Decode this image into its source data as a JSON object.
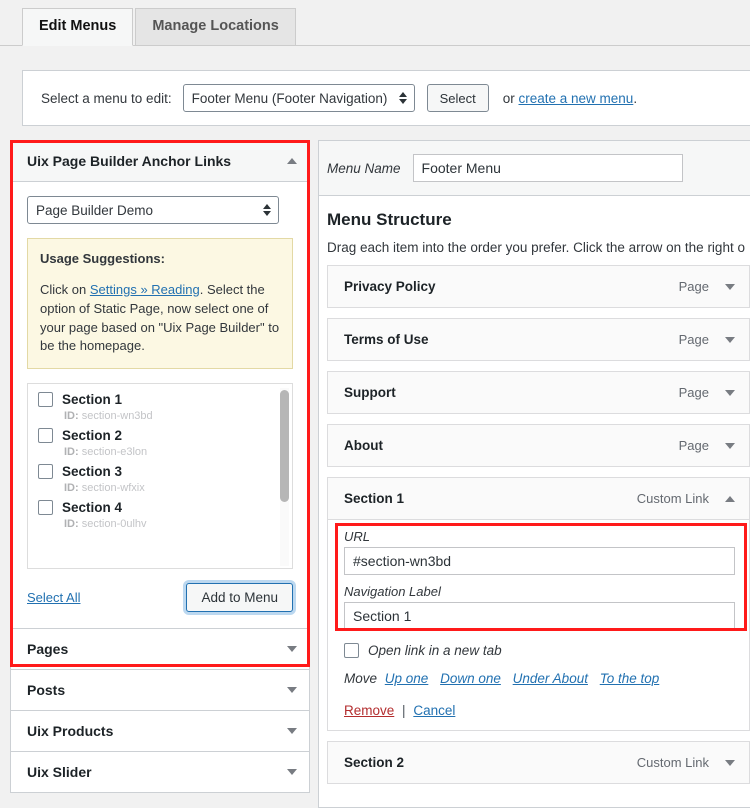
{
  "tabs": [
    {
      "label": "Edit Menus",
      "active": true
    },
    {
      "label": "Manage Locations",
      "active": false
    }
  ],
  "select_bar": {
    "label": "Select a menu to edit:",
    "selected_menu": "Footer Menu (Footer Navigation)",
    "select_button": "Select",
    "or_text": "or",
    "create_link": "create a new menu",
    "period": "."
  },
  "left_panel": {
    "anchor_box": {
      "title": "Uix Page Builder Anchor Links",
      "collapse_icon": "caret-up-icon",
      "page_select": "Page Builder Demo",
      "notice": {
        "heading": "Usage Suggestions:",
        "text_before": "Click on ",
        "link": "Settings » Reading",
        "text_after": ". Select the option of Static Page, now select one of your page based on \"Uix Page Builder\" to be the homepage."
      },
      "sections": [
        {
          "label": "Section 1",
          "id_prefix": "ID:",
          "id": "section-wn3bd",
          "checked": false
        },
        {
          "label": "Section 2",
          "id_prefix": "ID:",
          "id": "section-e3lon",
          "checked": false
        },
        {
          "label": "Section 3",
          "id_prefix": "ID:",
          "id": "section-wfxix",
          "checked": false
        },
        {
          "label": "Section 4",
          "id_prefix": "ID:",
          "id": "section-0ulhv",
          "checked": false
        }
      ],
      "select_all": "Select All",
      "add_to_menu": "Add to Menu"
    },
    "accordions": [
      {
        "title": "Pages",
        "icon": "caret-down-icon"
      },
      {
        "title": "Posts",
        "icon": "caret-down-icon"
      },
      {
        "title": "Uix Products",
        "icon": "caret-down-icon"
      },
      {
        "title": "Uix Slider",
        "icon": "caret-down-icon"
      }
    ]
  },
  "right_panel": {
    "menu_name_label": "Menu Name",
    "menu_name_value": "Footer Menu",
    "structure_title": "Menu Structure",
    "structure_desc": "Drag each item into the order you prefer. Click the arrow on the right o",
    "items": [
      {
        "title": "Privacy Policy",
        "type": "Page",
        "expanded": false,
        "icon": "caret-down-icon"
      },
      {
        "title": "Terms of Use",
        "type": "Page",
        "expanded": false,
        "icon": "caret-down-icon"
      },
      {
        "title": "Support",
        "type": "Page",
        "expanded": false,
        "icon": "caret-down-icon"
      },
      {
        "title": "About",
        "type": "Page",
        "expanded": false,
        "icon": "caret-down-icon"
      },
      {
        "title": "Section 1",
        "type": "Custom Link",
        "expanded": true,
        "icon": "caret-up-icon"
      },
      {
        "title": "Section 2",
        "type": "Custom Link",
        "expanded": false,
        "icon": "caret-down-icon"
      }
    ],
    "expanded_item": {
      "url_label": "URL",
      "url_value": "#section-wn3bd",
      "nav_label_label": "Navigation Label",
      "nav_label_value": "Section 1",
      "new_tab_label": "Open link in a new tab",
      "new_tab_checked": false,
      "move_label": "Move",
      "move_links": [
        "Up one",
        "Down one",
        "Under About",
        "To the top"
      ],
      "remove_label": "Remove",
      "separator": "|",
      "cancel_label": "Cancel"
    }
  },
  "colors": {
    "highlight_red": "#ff1a1a",
    "link_blue": "#2271b1",
    "notice_yellow": "#fcf8e3",
    "focus_blue": "#2271b1"
  }
}
